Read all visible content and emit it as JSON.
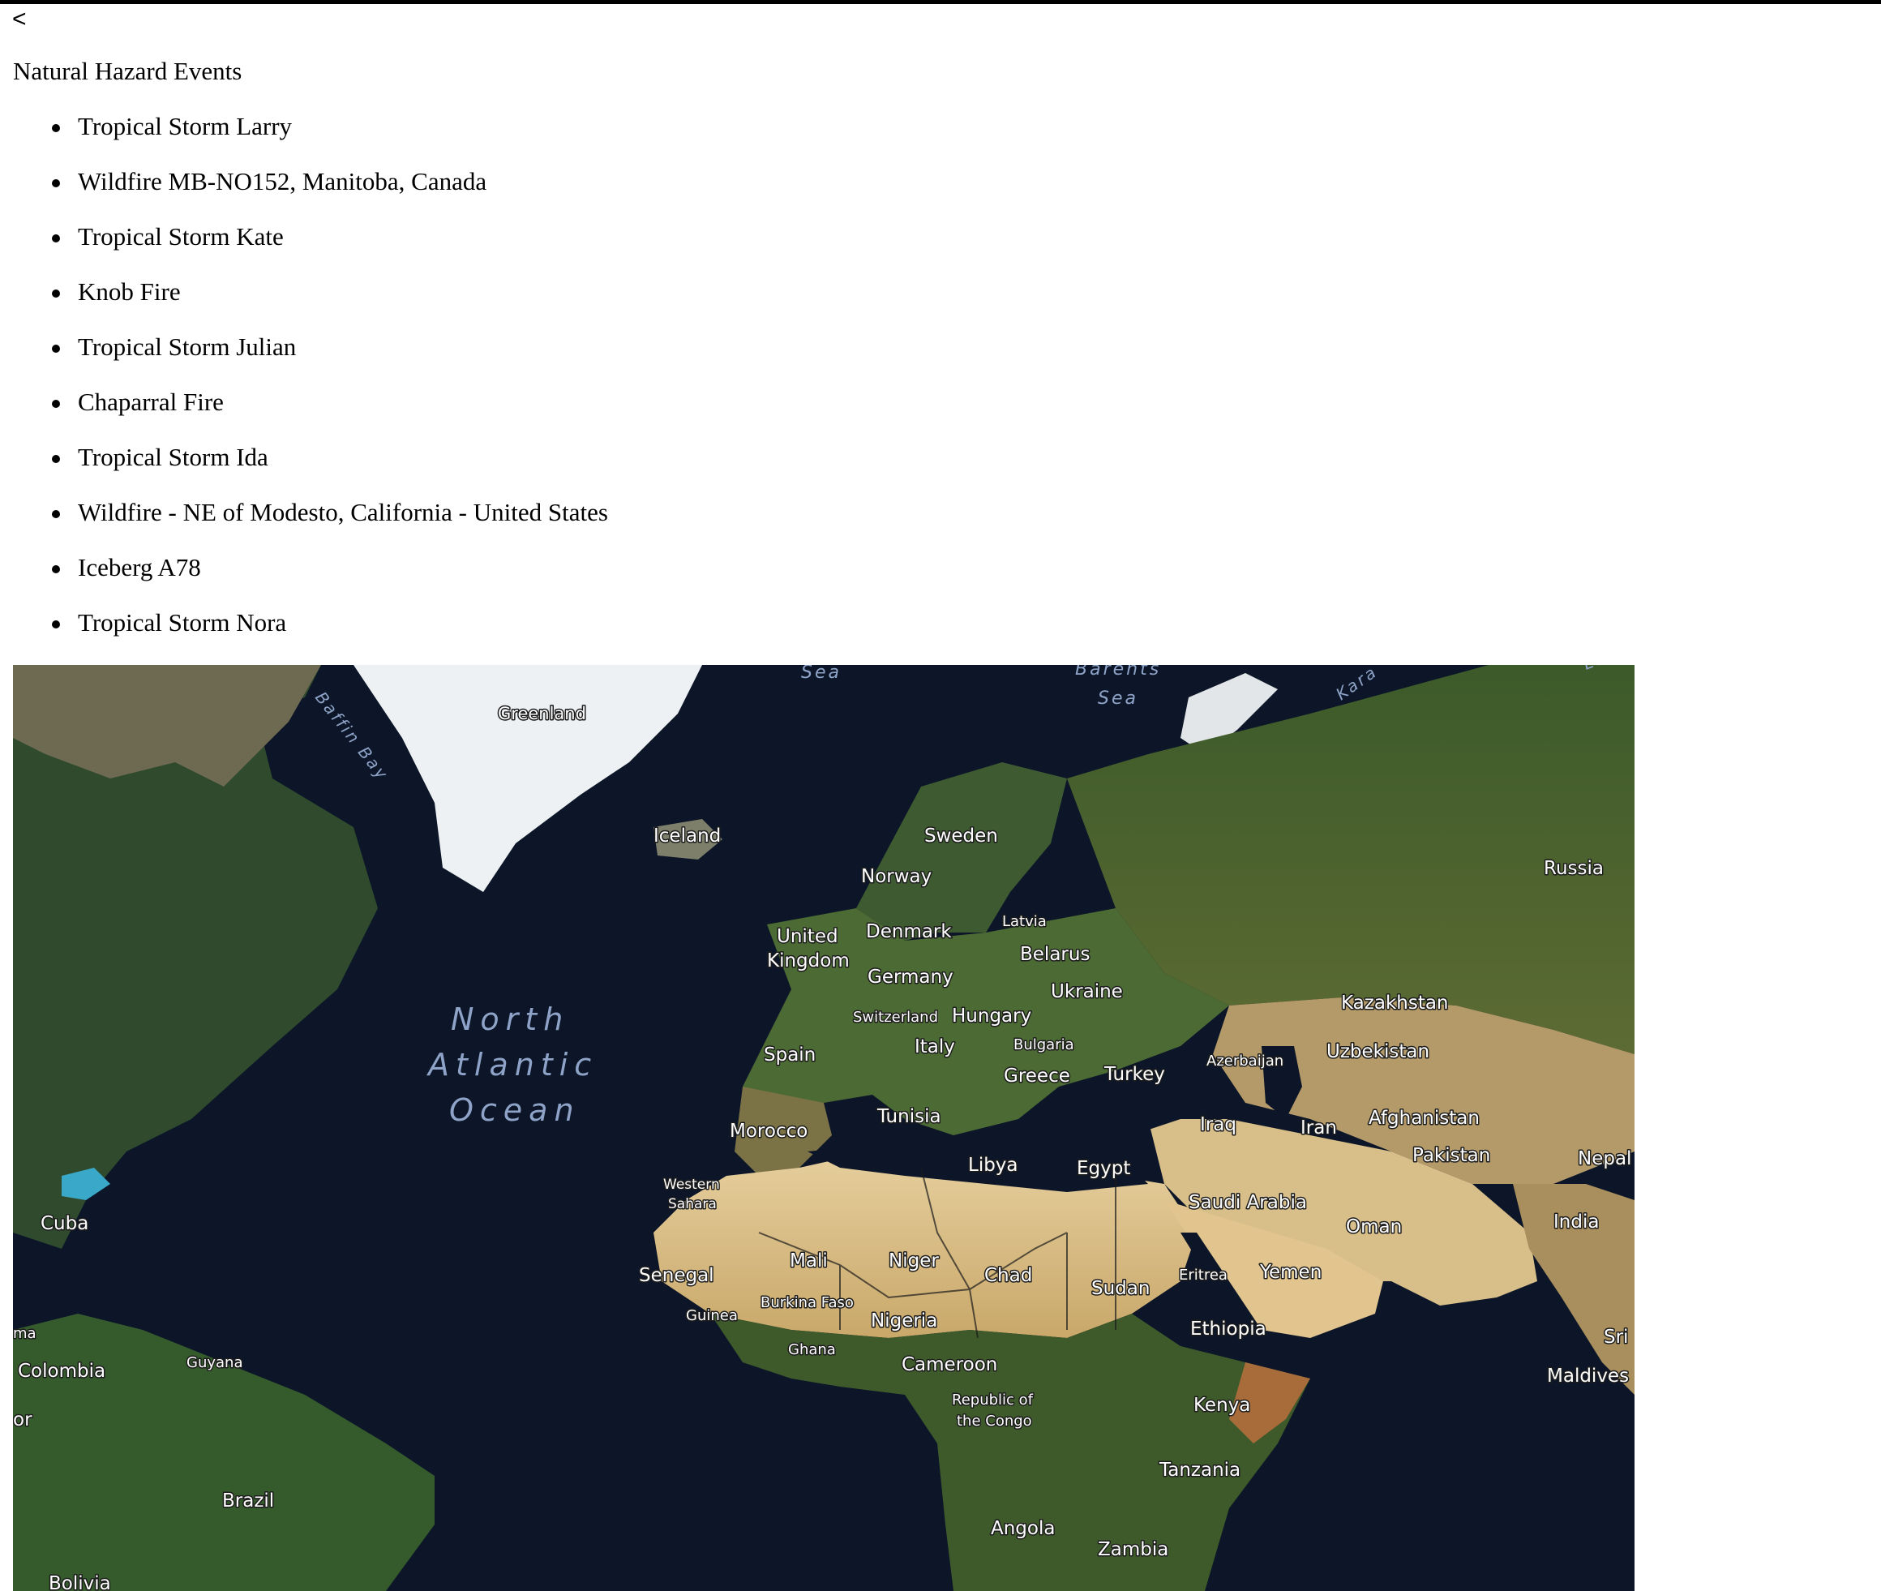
{
  "back_label": "<",
  "title": "Natural Hazard Events",
  "events": [
    "Tropical Storm Larry",
    "Wildfire MB-NO152, Manitoba, Canada",
    "Tropical Storm Kate",
    "Knob Fire",
    "Tropical Storm Julian",
    "Chaparral Fire",
    "Tropical Storm Ida",
    "Wildfire - NE of Modesto, California - United States",
    "Iceberg A78",
    "Tropical Storm Nora"
  ],
  "map": {
    "style": "satellite",
    "oceans": {
      "north_atlantic": [
        "North",
        "Atlantic",
        "Ocean"
      ],
      "barents": [
        "Barents",
        "Sea"
      ],
      "baffin_bay": "Baffin Bay",
      "norwegian_fragment": "Sea",
      "kara_fragment": "Kara",
      "laptev_fragment": "Laptev"
    },
    "countries": {
      "greenland": "Greenland",
      "iceland": "Iceland",
      "sweden": "Sweden",
      "norway": "Norway",
      "russia": "Russia",
      "latvia": "Latvia",
      "united_kingdom": [
        "United",
        "Kingdom"
      ],
      "denmark": "Denmark",
      "belarus": "Belarus",
      "germany": "Germany",
      "ukraine": "Ukraine",
      "kazakhstan": "Kazakhstan",
      "switzerland": "Switzerland",
      "hungary": "Hungary",
      "italy": "Italy",
      "bulgaria": "Bulgaria",
      "spain": "Spain",
      "azerbaijan": "Azerbaijan",
      "uzbekistan": "Uzbekistan",
      "greece": "Greece",
      "turkey": "Turkey",
      "tunisia": "Tunisia",
      "morocco": "Morocco",
      "iraq": "Iraq",
      "iran": "Iran",
      "afghanistan": "Afghanistan",
      "libya": "Libya",
      "egypt": "Egypt",
      "pakistan": "Pakistan",
      "nepal": "Nepal",
      "western_sahara": [
        "Western",
        "Sahara"
      ],
      "saudi_arabia": "Saudi Arabia",
      "oman": "Oman",
      "cuba": "Cuba",
      "india": "India",
      "mali": "Mali",
      "niger": "Niger",
      "senegal": "Senegal",
      "chad": "Chad",
      "eritrea": "Eritrea",
      "yemen": "Yemen",
      "sudan": "Sudan",
      "burkina_faso": "Burkina Faso",
      "guinea": "Guinea",
      "nigeria": "Nigeria",
      "ethiopia": "Ethiopia",
      "ghana": "Ghana",
      "sri_fragment": "Sri",
      "panama_fragment": "ma",
      "guyana": "Guyana",
      "colombia": "Colombia",
      "cameroon": "Cameroon",
      "maldives": "Maldives",
      "congo": [
        "Republic of",
        "the Congo"
      ],
      "kenya": "Kenya",
      "ecuador_fragment": "or",
      "tanzania": "Tanzania",
      "brazil": "Brazil",
      "angola": "Angola",
      "zambia": "Zambia",
      "bolivia": "Bolivia"
    }
  }
}
